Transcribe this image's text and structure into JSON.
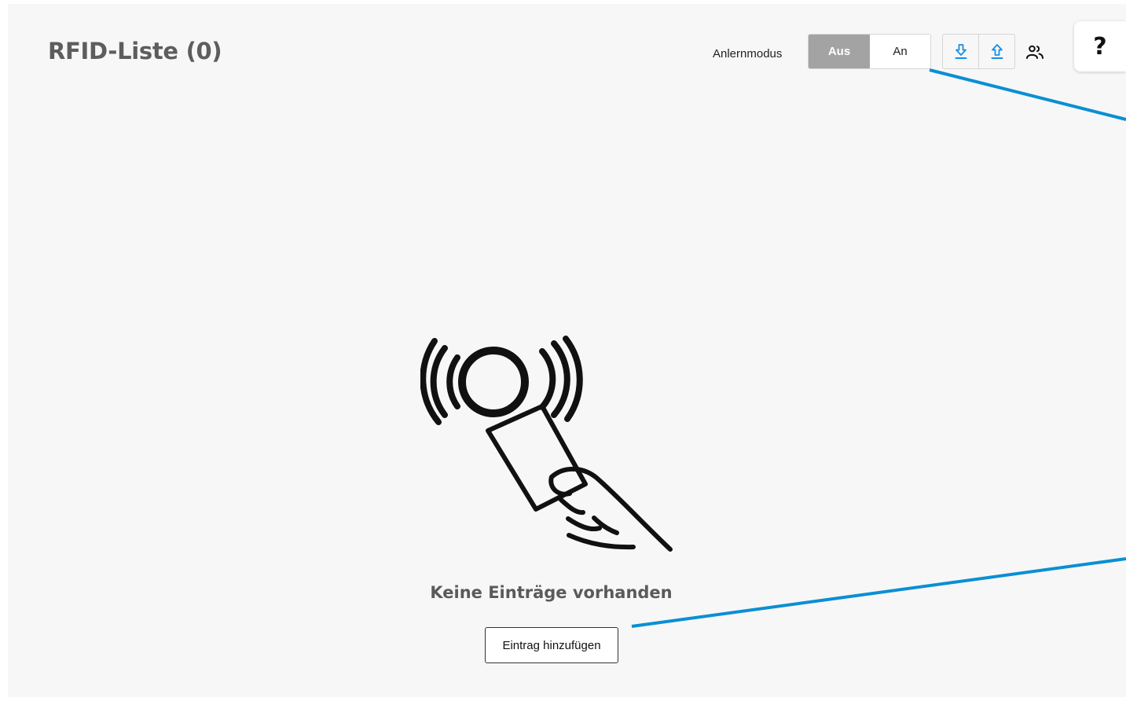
{
  "header": {
    "title": "RFID-Liste (0)",
    "learn_mode": {
      "label": "Anlernmodus",
      "options": [
        "Aus",
        "An"
      ],
      "selected": "Aus"
    },
    "actions": {
      "download_icon": "download-arrow-icon",
      "upload_icon": "upload-arrow-icon",
      "users_icon": "users-icon"
    },
    "help": "?"
  },
  "empty_state": {
    "illustration": "hand-holding-rfid-card-icon",
    "message": "Keine Einträge vorhanden",
    "add_button": "Eintrag hinzufügen"
  },
  "colors": {
    "accent": "#1a8ee6",
    "callout_line": "#0a8fd3",
    "toggle_selected": "#a3a3a3",
    "background": "#f7f7f7",
    "title": "#5d5d5d"
  }
}
